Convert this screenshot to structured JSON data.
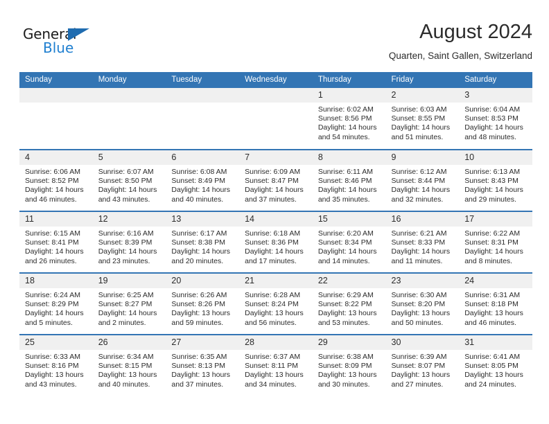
{
  "brand": {
    "name_part1": "General",
    "name_part2": "Blue",
    "triangle_color": "#1f6cb0",
    "blue_color": "#1f7fd0"
  },
  "header": {
    "title": "August 2024",
    "location": "Quarten, Saint Gallen, Switzerland"
  },
  "theme": {
    "header_blue": "#3375b4",
    "daynum_band": "#f0f0f0",
    "text": "#2b2b2b"
  },
  "weekdays": [
    "Sunday",
    "Monday",
    "Tuesday",
    "Wednesday",
    "Thursday",
    "Friday",
    "Saturday"
  ],
  "weeks": [
    [
      {
        "day": "",
        "sunrise": "",
        "sunset": "",
        "daylight_line1": "",
        "daylight_line2": ""
      },
      {
        "day": "",
        "sunrise": "",
        "sunset": "",
        "daylight_line1": "",
        "daylight_line2": ""
      },
      {
        "day": "",
        "sunrise": "",
        "sunset": "",
        "daylight_line1": "",
        "daylight_line2": ""
      },
      {
        "day": "",
        "sunrise": "",
        "sunset": "",
        "daylight_line1": "",
        "daylight_line2": ""
      },
      {
        "day": "1",
        "sunrise": "Sunrise: 6:02 AM",
        "sunset": "Sunset: 8:56 PM",
        "daylight_line1": "Daylight: 14 hours",
        "daylight_line2": "and 54 minutes."
      },
      {
        "day": "2",
        "sunrise": "Sunrise: 6:03 AM",
        "sunset": "Sunset: 8:55 PM",
        "daylight_line1": "Daylight: 14 hours",
        "daylight_line2": "and 51 minutes."
      },
      {
        "day": "3",
        "sunrise": "Sunrise: 6:04 AM",
        "sunset": "Sunset: 8:53 PM",
        "daylight_line1": "Daylight: 14 hours",
        "daylight_line2": "and 48 minutes."
      }
    ],
    [
      {
        "day": "4",
        "sunrise": "Sunrise: 6:06 AM",
        "sunset": "Sunset: 8:52 PM",
        "daylight_line1": "Daylight: 14 hours",
        "daylight_line2": "and 46 minutes."
      },
      {
        "day": "5",
        "sunrise": "Sunrise: 6:07 AM",
        "sunset": "Sunset: 8:50 PM",
        "daylight_line1": "Daylight: 14 hours",
        "daylight_line2": "and 43 minutes."
      },
      {
        "day": "6",
        "sunrise": "Sunrise: 6:08 AM",
        "sunset": "Sunset: 8:49 PM",
        "daylight_line1": "Daylight: 14 hours",
        "daylight_line2": "and 40 minutes."
      },
      {
        "day": "7",
        "sunrise": "Sunrise: 6:09 AM",
        "sunset": "Sunset: 8:47 PM",
        "daylight_line1": "Daylight: 14 hours",
        "daylight_line2": "and 37 minutes."
      },
      {
        "day": "8",
        "sunrise": "Sunrise: 6:11 AM",
        "sunset": "Sunset: 8:46 PM",
        "daylight_line1": "Daylight: 14 hours",
        "daylight_line2": "and 35 minutes."
      },
      {
        "day": "9",
        "sunrise": "Sunrise: 6:12 AM",
        "sunset": "Sunset: 8:44 PM",
        "daylight_line1": "Daylight: 14 hours",
        "daylight_line2": "and 32 minutes."
      },
      {
        "day": "10",
        "sunrise": "Sunrise: 6:13 AM",
        "sunset": "Sunset: 8:43 PM",
        "daylight_line1": "Daylight: 14 hours",
        "daylight_line2": "and 29 minutes."
      }
    ],
    [
      {
        "day": "11",
        "sunrise": "Sunrise: 6:15 AM",
        "sunset": "Sunset: 8:41 PM",
        "daylight_line1": "Daylight: 14 hours",
        "daylight_line2": "and 26 minutes."
      },
      {
        "day": "12",
        "sunrise": "Sunrise: 6:16 AM",
        "sunset": "Sunset: 8:39 PM",
        "daylight_line1": "Daylight: 14 hours",
        "daylight_line2": "and 23 minutes."
      },
      {
        "day": "13",
        "sunrise": "Sunrise: 6:17 AM",
        "sunset": "Sunset: 8:38 PM",
        "daylight_line1": "Daylight: 14 hours",
        "daylight_line2": "and 20 minutes."
      },
      {
        "day": "14",
        "sunrise": "Sunrise: 6:18 AM",
        "sunset": "Sunset: 8:36 PM",
        "daylight_line1": "Daylight: 14 hours",
        "daylight_line2": "and 17 minutes."
      },
      {
        "day": "15",
        "sunrise": "Sunrise: 6:20 AM",
        "sunset": "Sunset: 8:34 PM",
        "daylight_line1": "Daylight: 14 hours",
        "daylight_line2": "and 14 minutes."
      },
      {
        "day": "16",
        "sunrise": "Sunrise: 6:21 AM",
        "sunset": "Sunset: 8:33 PM",
        "daylight_line1": "Daylight: 14 hours",
        "daylight_line2": "and 11 minutes."
      },
      {
        "day": "17",
        "sunrise": "Sunrise: 6:22 AM",
        "sunset": "Sunset: 8:31 PM",
        "daylight_line1": "Daylight: 14 hours",
        "daylight_line2": "and 8 minutes."
      }
    ],
    [
      {
        "day": "18",
        "sunrise": "Sunrise: 6:24 AM",
        "sunset": "Sunset: 8:29 PM",
        "daylight_line1": "Daylight: 14 hours",
        "daylight_line2": "and 5 minutes."
      },
      {
        "day": "19",
        "sunrise": "Sunrise: 6:25 AM",
        "sunset": "Sunset: 8:27 PM",
        "daylight_line1": "Daylight: 14 hours",
        "daylight_line2": "and 2 minutes."
      },
      {
        "day": "20",
        "sunrise": "Sunrise: 6:26 AM",
        "sunset": "Sunset: 8:26 PM",
        "daylight_line1": "Daylight: 13 hours",
        "daylight_line2": "and 59 minutes."
      },
      {
        "day": "21",
        "sunrise": "Sunrise: 6:28 AM",
        "sunset": "Sunset: 8:24 PM",
        "daylight_line1": "Daylight: 13 hours",
        "daylight_line2": "and 56 minutes."
      },
      {
        "day": "22",
        "sunrise": "Sunrise: 6:29 AM",
        "sunset": "Sunset: 8:22 PM",
        "daylight_line1": "Daylight: 13 hours",
        "daylight_line2": "and 53 minutes."
      },
      {
        "day": "23",
        "sunrise": "Sunrise: 6:30 AM",
        "sunset": "Sunset: 8:20 PM",
        "daylight_line1": "Daylight: 13 hours",
        "daylight_line2": "and 50 minutes."
      },
      {
        "day": "24",
        "sunrise": "Sunrise: 6:31 AM",
        "sunset": "Sunset: 8:18 PM",
        "daylight_line1": "Daylight: 13 hours",
        "daylight_line2": "and 46 minutes."
      }
    ],
    [
      {
        "day": "25",
        "sunrise": "Sunrise: 6:33 AM",
        "sunset": "Sunset: 8:16 PM",
        "daylight_line1": "Daylight: 13 hours",
        "daylight_line2": "and 43 minutes."
      },
      {
        "day": "26",
        "sunrise": "Sunrise: 6:34 AM",
        "sunset": "Sunset: 8:15 PM",
        "daylight_line1": "Daylight: 13 hours",
        "daylight_line2": "and 40 minutes."
      },
      {
        "day": "27",
        "sunrise": "Sunrise: 6:35 AM",
        "sunset": "Sunset: 8:13 PM",
        "daylight_line1": "Daylight: 13 hours",
        "daylight_line2": "and 37 minutes."
      },
      {
        "day": "28",
        "sunrise": "Sunrise: 6:37 AM",
        "sunset": "Sunset: 8:11 PM",
        "daylight_line1": "Daylight: 13 hours",
        "daylight_line2": "and 34 minutes."
      },
      {
        "day": "29",
        "sunrise": "Sunrise: 6:38 AM",
        "sunset": "Sunset: 8:09 PM",
        "daylight_line1": "Daylight: 13 hours",
        "daylight_line2": "and 30 minutes."
      },
      {
        "day": "30",
        "sunrise": "Sunrise: 6:39 AM",
        "sunset": "Sunset: 8:07 PM",
        "daylight_line1": "Daylight: 13 hours",
        "daylight_line2": "and 27 minutes."
      },
      {
        "day": "31",
        "sunrise": "Sunrise: 6:41 AM",
        "sunset": "Sunset: 8:05 PM",
        "daylight_line1": "Daylight: 13 hours",
        "daylight_line2": "and 24 minutes."
      }
    ]
  ]
}
